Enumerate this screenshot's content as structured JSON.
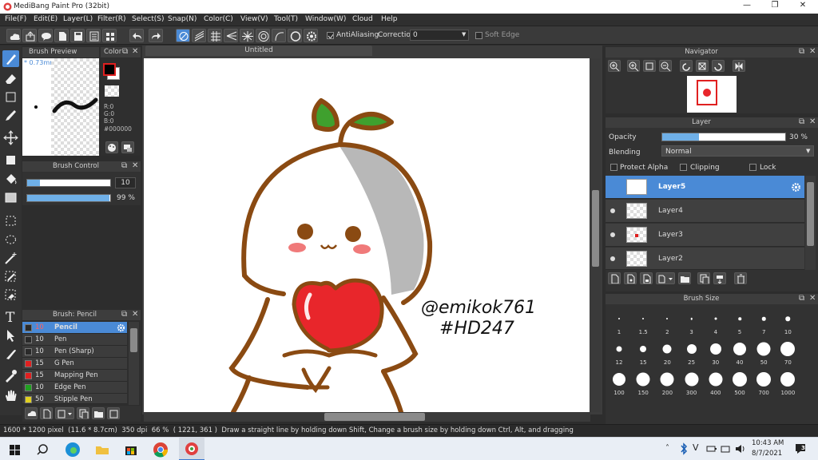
{
  "app": {
    "title": "MediBang Paint Pro (32bit)"
  },
  "menu": [
    "File(F)",
    "Edit(E)",
    "Layer(L)",
    "Filter(R)",
    "Select(S)",
    "Snap(N)",
    "Color(C)",
    "View(V)",
    "Tool(T)",
    "Window(W)",
    "Cloud",
    "Help"
  ],
  "toolbar": {
    "antialiasing_label": "AntiAliasing",
    "correction_label": "Correction",
    "correction_value": "0",
    "soft_edge_label": "Soft Edge"
  },
  "brush_preview": {
    "title": "Brush Preview",
    "size": "0.73mm"
  },
  "color_panel": {
    "title": "Color",
    "r": "R:0",
    "g": "G:0",
    "b": "B:0",
    "hex": "#000000"
  },
  "brush_control": {
    "title": "Brush Control",
    "size_value": "10",
    "opacity_value": "99 %",
    "size_fraction": 0.15,
    "opacity_fraction": 0.99
  },
  "brush_list": {
    "title": "Brush: Pencil",
    "items": [
      {
        "size": "10",
        "name": "Pencil",
        "color": "#2a2a2a"
      },
      {
        "size": "10",
        "name": "Pen",
        "color": "#2a2a2a"
      },
      {
        "size": "10",
        "name": "Pen (Sharp)",
        "color": "#2a2a2a"
      },
      {
        "size": "15",
        "name": "G Pen",
        "color": "#e02020"
      },
      {
        "size": "15",
        "name": "Mapping Pen",
        "color": "#e02020"
      },
      {
        "size": "10",
        "name": "Edge Pen",
        "color": "#20a020"
      },
      {
        "size": "50",
        "name": "Stipple Pen",
        "color": "#e0d020"
      }
    ]
  },
  "canvas": {
    "tab": "Untitled",
    "handwriting_line1": "@emikok761",
    "handwriting_line2": "#HD247"
  },
  "navigator": {
    "title": "Navigator"
  },
  "layer_panel": {
    "title": "Layer",
    "opacity_label": "Opacity",
    "opacity_value": "30 %",
    "opacity_fraction": 0.3,
    "blending_label": "Blending",
    "blending_value": "Normal",
    "protect_alpha": "Protect Alpha",
    "clipping": "Clipping",
    "lock": "Lock",
    "layers": [
      "Layer5",
      "Layer4",
      "Layer3",
      "Layer2"
    ]
  },
  "brush_size": {
    "title": "Brush Size",
    "sizes": [
      "1",
      "1.5",
      "2",
      "3",
      "4",
      "5",
      "7",
      "10",
      "12",
      "15",
      "20",
      "25",
      "30",
      "40",
      "50",
      "70",
      "100",
      "150",
      "200",
      "300",
      "400",
      "500",
      "700",
      "1000"
    ]
  },
  "status": {
    "text": "1600 * 1200 pixel  (11.6 * 8.7cm)  350 dpi  66 %  ( 1221, 361 )  Draw a straight line by holding down Shift, Change a brush size by holding down Ctrl, Alt, and dragging"
  },
  "taskbar": {
    "time": "10:43 AM",
    "date": "8/7/2021",
    "notifications": "3"
  },
  "colors": {
    "accent": "#4a8ad6",
    "panel": "#323232",
    "apple_red": "#e8262b",
    "leaf_green": "#3fa02e",
    "outline_brown": "#8a4a12"
  }
}
